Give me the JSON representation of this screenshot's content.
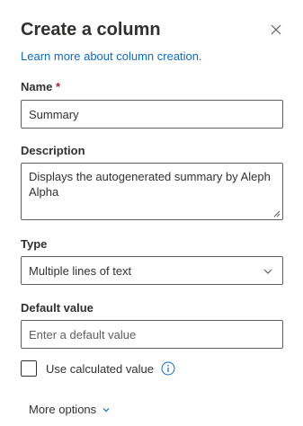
{
  "panel": {
    "title": "Create a column",
    "learn_link": "Learn more about column creation."
  },
  "name_field": {
    "label": "Name",
    "required_marker": "*",
    "value": "Summary"
  },
  "description_field": {
    "label": "Description",
    "value": "Displays the autogenerated summary by Aleph Alpha"
  },
  "type_field": {
    "label": "Type",
    "selected": "Multiple lines of text"
  },
  "default_value_field": {
    "label": "Default value",
    "placeholder": "Enter a default value"
  },
  "calculated": {
    "label": "Use calculated value",
    "checked": false
  },
  "more_options": {
    "label": "More options"
  },
  "colors": {
    "accent": "#0f6cbd",
    "text": "#323130",
    "required": "#a4262c"
  },
  "icons": {
    "close": "close-icon",
    "dropdown": "chevron-down-icon",
    "info": "info-icon",
    "more_chevron": "chevron-down-icon"
  }
}
